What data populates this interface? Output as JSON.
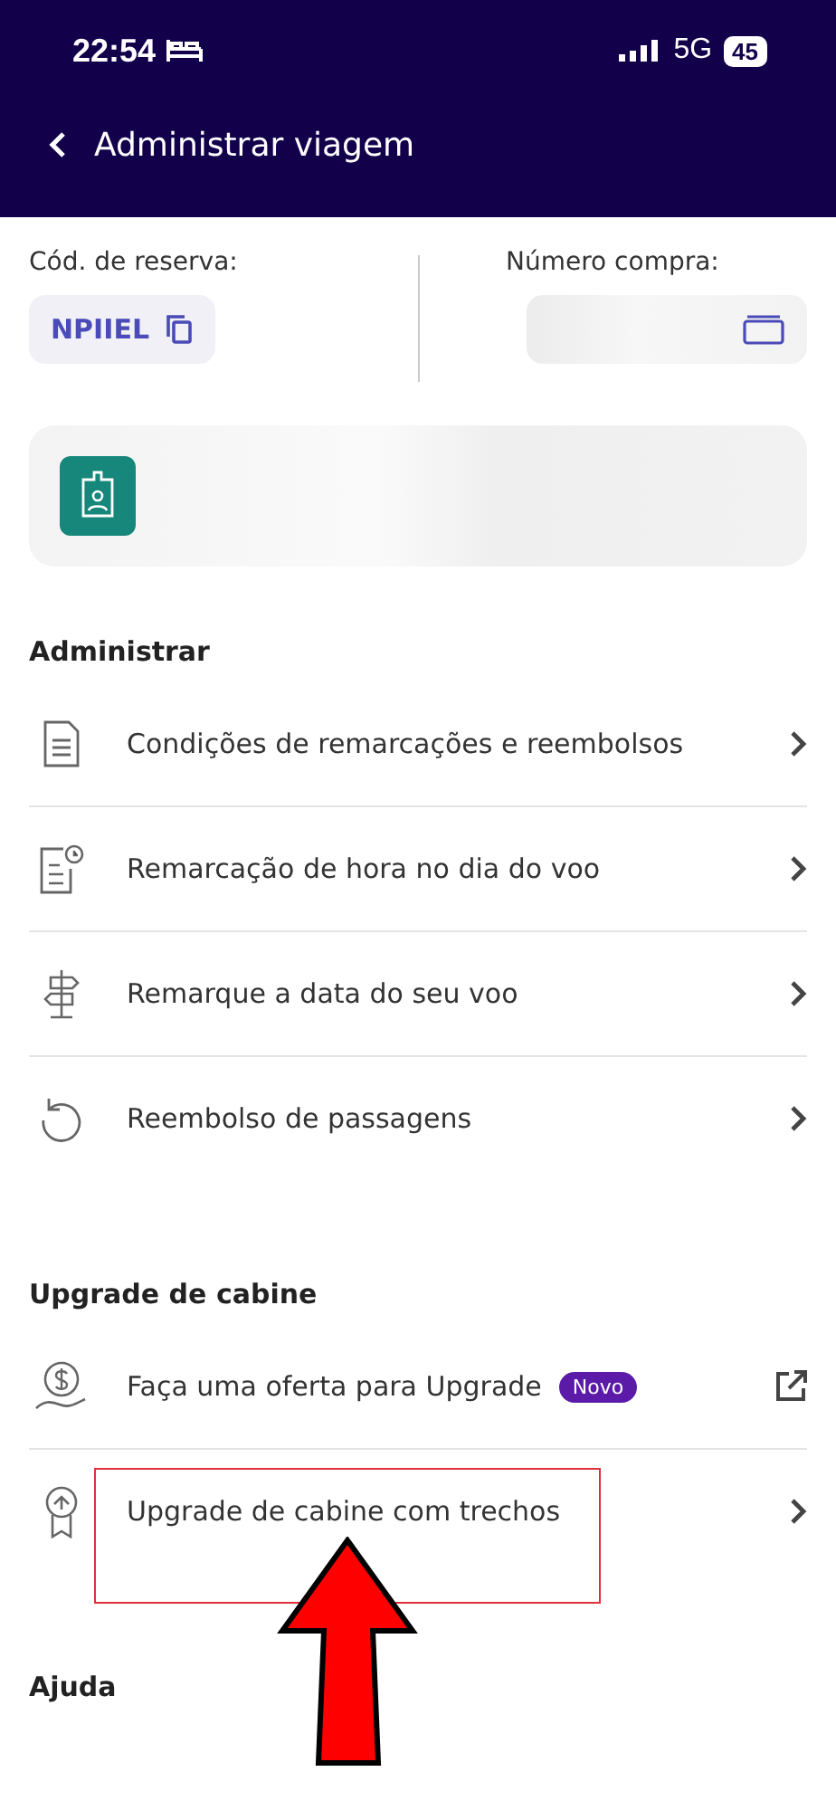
{
  "status_bar": {
    "time": "22:54",
    "network": "5G",
    "battery": "45"
  },
  "header": {
    "title": "Administrar viagem"
  },
  "codes": {
    "booking_label": "Cód. de reserva:",
    "booking_code": "NPIIEL",
    "purchase_label": "Número compra:"
  },
  "sections": [
    {
      "title": "Administrar",
      "items": [
        {
          "label": "Condições de remarcações e reembolsos",
          "kind": "chevron"
        },
        {
          "label": "Remarcação de hora no dia do voo",
          "kind": "chevron"
        },
        {
          "label": "Remarque a data do seu voo",
          "kind": "chevron"
        },
        {
          "label": "Reembolso de passagens",
          "kind": "chevron"
        }
      ]
    },
    {
      "title": "Upgrade de cabine",
      "items": [
        {
          "label": "Faça uma oferta para Upgrade",
          "badge": "Novo",
          "kind": "external"
        },
        {
          "label": "Upgrade de cabine com trechos",
          "kind": "chevron",
          "highlighted": true
        }
      ]
    },
    {
      "title": "Ajuda"
    }
  ]
}
